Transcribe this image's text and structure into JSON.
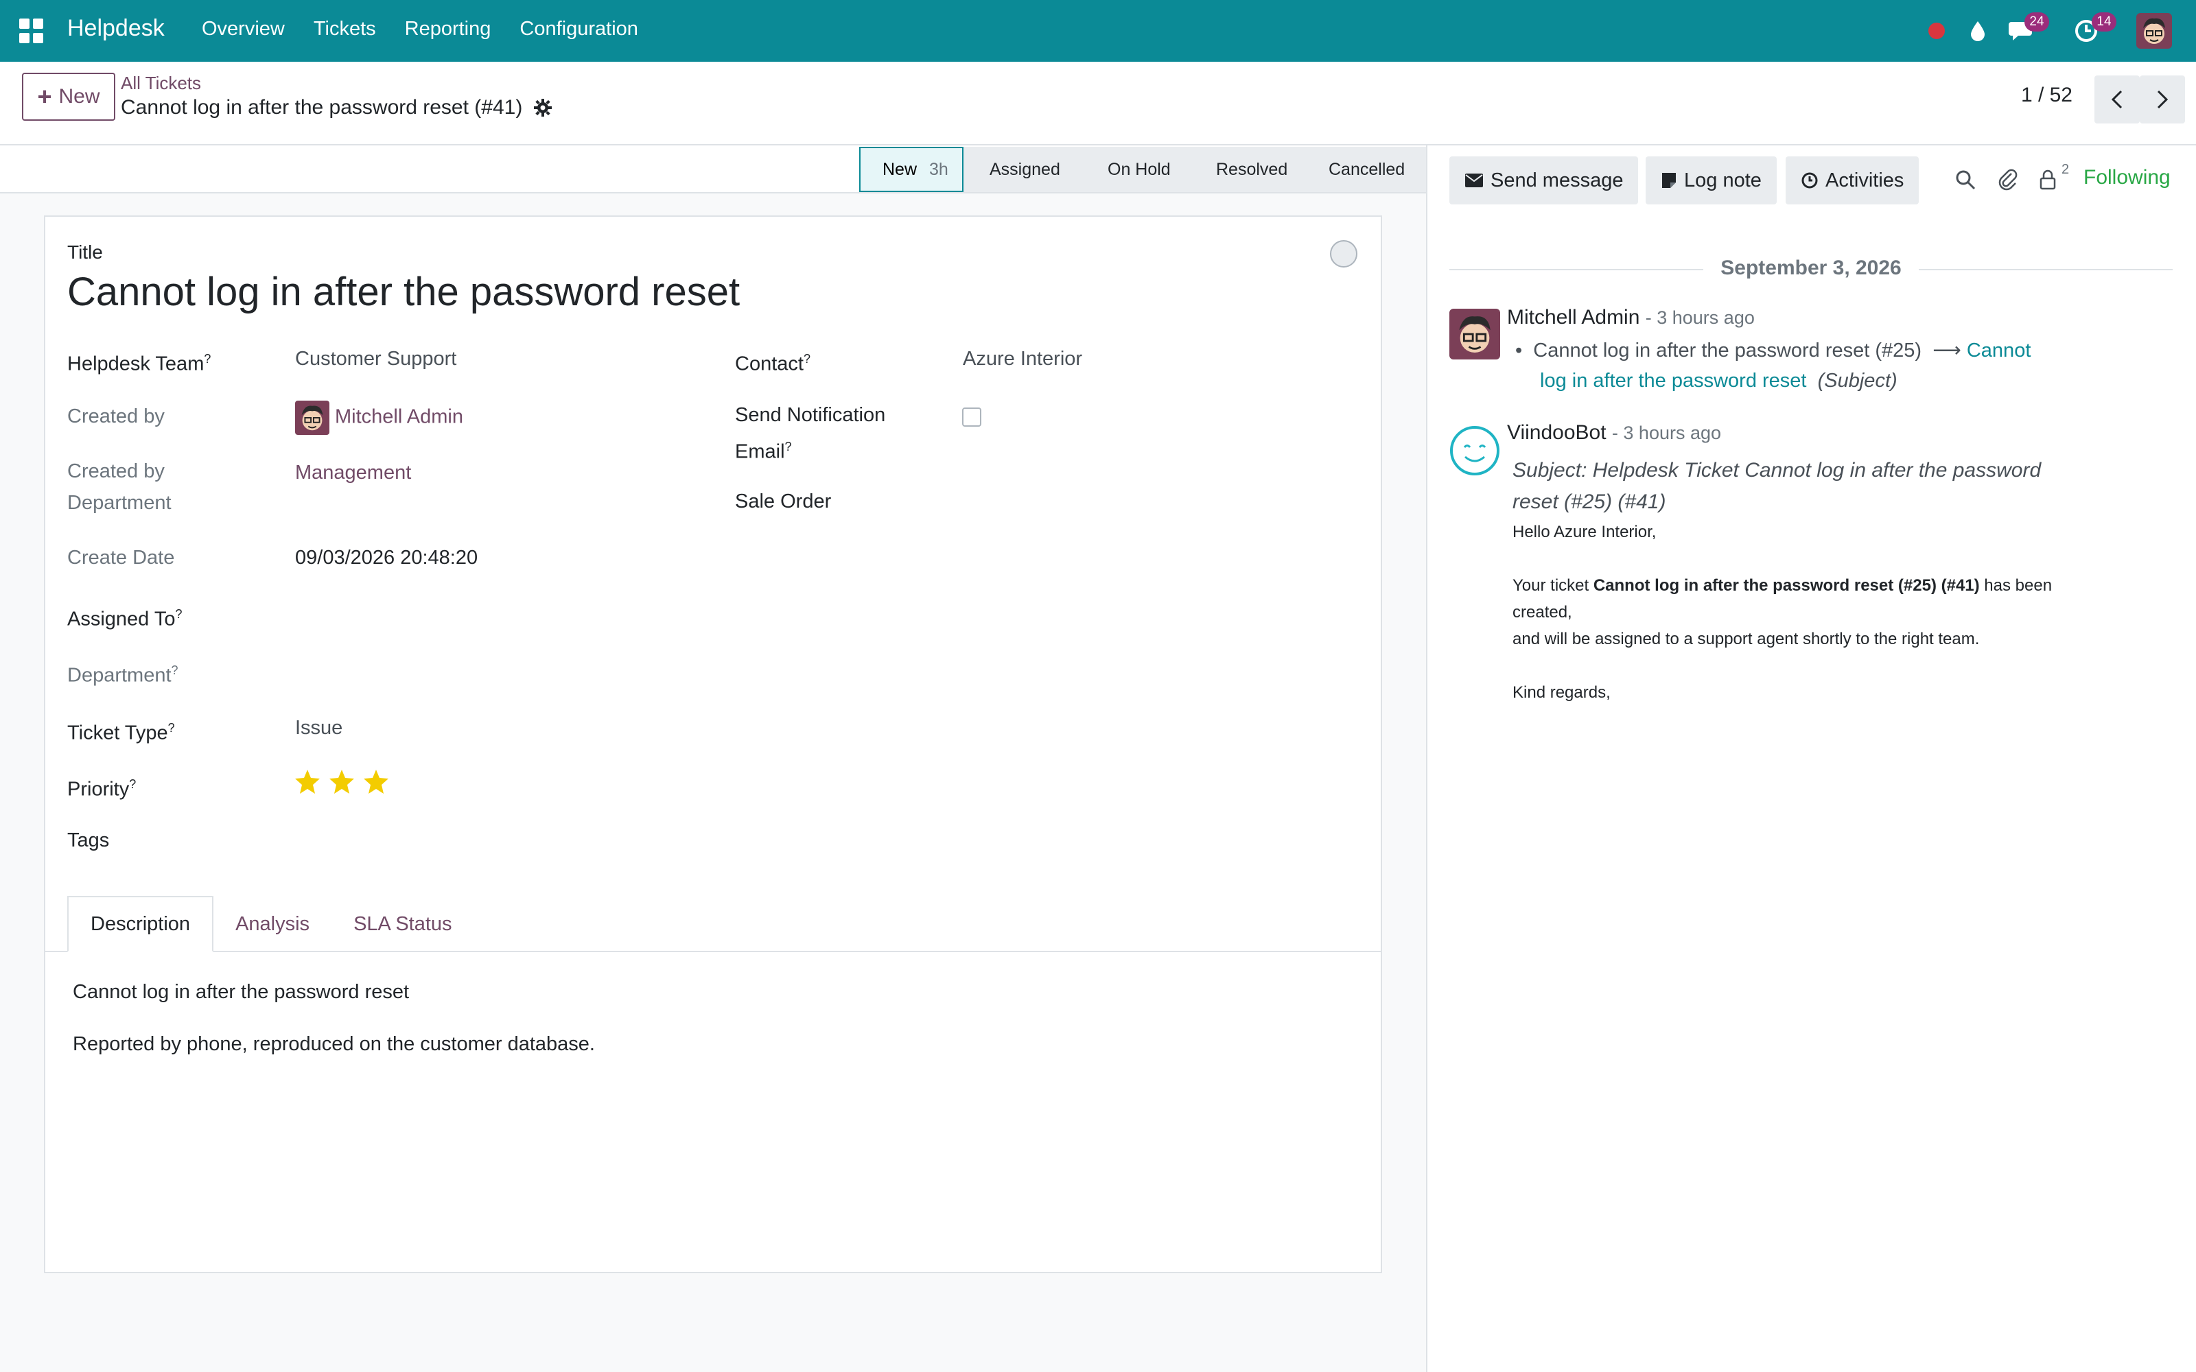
{
  "navbar": {
    "brand": "Helpdesk",
    "menu": [
      "Overview",
      "Tickets",
      "Reporting",
      "Configuration"
    ],
    "messages_badge": "24",
    "activities_badge": "14"
  },
  "control_panel": {
    "new_label": "New",
    "breadcrumb_parent": "All Tickets",
    "breadcrumb_current": "Cannot log in after the password reset (#41)",
    "pager_value": "1 / 52"
  },
  "statusbar": {
    "stages": [
      {
        "label": "New",
        "duration": "3h",
        "active": true
      },
      {
        "label": "Assigned"
      },
      {
        "label": "On Hold"
      },
      {
        "label": "Resolved"
      },
      {
        "label": "Cancelled"
      }
    ]
  },
  "form": {
    "title_label": "Title",
    "title": "Cannot log in after the password reset",
    "left_fields": {
      "helpdesk_team": {
        "label": "Helpdesk Team",
        "value": "Customer Support"
      },
      "created_by": {
        "label": "Created by",
        "value": "Mitchell Admin"
      },
      "created_by_department": {
        "label_line1": "Created by",
        "label_line2": "Department",
        "value": "Management"
      },
      "create_date": {
        "label": "Create Date",
        "value": "09/03/2026 20:48:20"
      },
      "assigned_to": {
        "label": "Assigned To",
        "value": ""
      },
      "department": {
        "label": "Department",
        "value": ""
      },
      "ticket_type": {
        "label": "Ticket Type",
        "value": "Issue"
      },
      "priority": {
        "label": "Priority",
        "stars": 3
      },
      "tags": {
        "label": "Tags",
        "value": ""
      }
    },
    "right_fields": {
      "contact": {
        "label": "Contact",
        "value": "Azure Interior"
      },
      "send_notification": {
        "label_line1": "Send Notification",
        "label_line2": "Email",
        "checked": false
      },
      "sale_order": {
        "label": "Sale Order",
        "value": ""
      }
    },
    "help_mark": "?",
    "tabs": [
      "Description",
      "Analysis",
      "SLA Status"
    ],
    "description": [
      "Cannot log in after the password reset",
      "Reported by phone, reproduced on the customer database."
    ]
  },
  "chatter": {
    "buttons": {
      "send_message": "Send message",
      "log_note": "Log note",
      "activities": "Activities"
    },
    "followers_count": "2",
    "following_label": "Following",
    "date_separator": "September 3, 2026",
    "messages": [
      {
        "author": "Mitchell Admin",
        "time": "- 3 hours ago",
        "change_old": "Cannot log in after the password reset (#25)",
        "change_new_line1": "Cannot",
        "change_new_line2": "log in after the password reset",
        "change_field": "(Subject)"
      },
      {
        "author": "ViindooBot",
        "time": "- 3 hours ago",
        "subject_line1": "Subject: Helpdesk Ticket Cannot log in after the password",
        "subject_line2": "reset (#25) (#41)",
        "greeting": "Hello Azure Interior,",
        "body_prefix": "Your ticket ",
        "body_bold": "Cannot log in after the password reset (#25) (#41)",
        "body_suffix": " has been",
        "body_line2": "created,",
        "body_line3": "and will be assigned to a support agent shortly to the right team.",
        "closing": "Kind regards,"
      }
    ]
  },
  "colors": {
    "navbar": "#0b8a96",
    "primary": "#714B67",
    "link": "#0b8a96",
    "following": "#28a745",
    "star": "#f3cc00",
    "badge": "#9b2d7b"
  }
}
